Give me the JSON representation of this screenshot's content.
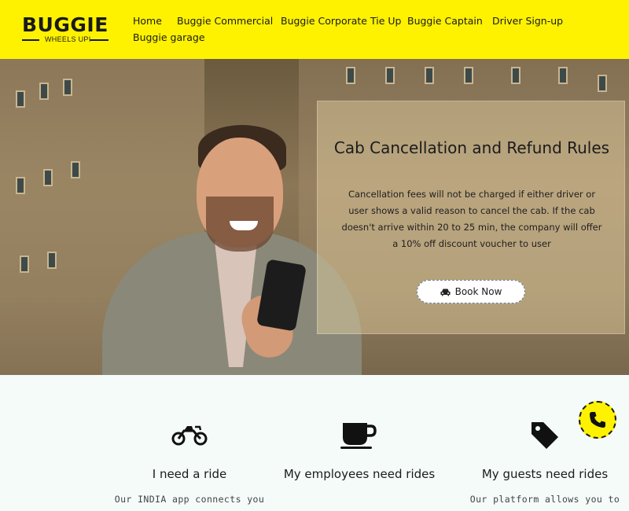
{
  "brand": {
    "name": "BUGGIE",
    "tagline": "WHEELS UP!"
  },
  "nav": [
    {
      "label": "Home"
    },
    {
      "label": "Buggie Commercial"
    },
    {
      "label": "Buggie Corporate Tie Up"
    },
    {
      "label": "Buggie Captain"
    },
    {
      "label": "Driver Sign-up"
    },
    {
      "label": "Buggie garage"
    }
  ],
  "hero": {
    "title": "Cab Cancellation and Refund Rules",
    "text": "Cancellation fees will not be charged if either driver or user shows a valid reason to cancel the cab. If the cab doesn't arrive within 20 to 25 min, the company will offer a 10% off discount voucher to user",
    "button_label": "Book Now",
    "button_icon": "car-icon"
  },
  "features": [
    {
      "icon": "motorcycle-icon",
      "title": "I need a ride",
      "desc": "Our INDIA app connects you"
    },
    {
      "icon": "coffee-cup-icon",
      "title": "My employees need rides",
      "desc": ""
    },
    {
      "icon": "tag-icon",
      "title": "My guests need rides",
      "desc": "Our platform allows you to"
    }
  ],
  "call_button": {
    "icon": "phone-icon"
  },
  "colors": {
    "brand_yellow": "#fef200",
    "text_dark": "#1b1b1b",
    "section_bg": "#f4fbf9"
  }
}
